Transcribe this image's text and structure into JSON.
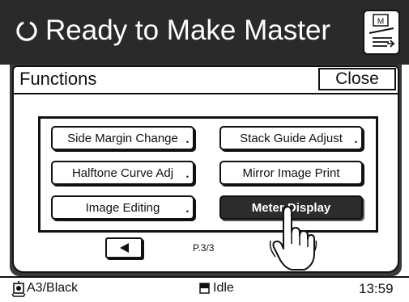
{
  "header": {
    "title": "Ready to Make Master",
    "status_icon": "circular-arrow-icon",
    "mode_icon": "master-mode-icon"
  },
  "panel": {
    "title": "Functions",
    "close_label": "Close"
  },
  "functions": [
    {
      "label": "Side Margin Change",
      "has_submenu": true,
      "selected": false
    },
    {
      "label": "Stack Guide Adjust",
      "has_submenu": true,
      "selected": false
    },
    {
      "label": "Halftone Curve Adj",
      "has_submenu": true,
      "selected": false
    },
    {
      "label": "Mirror Image Print",
      "has_submenu": false,
      "selected": false
    },
    {
      "label": "Image Editing",
      "has_submenu": true,
      "selected": false
    },
    {
      "label": "Meter Display",
      "has_submenu": false,
      "selected": true
    }
  ],
  "pager": {
    "page_label": "P.3/3",
    "prev_icon": "left-arrow-icon"
  },
  "status_bar": {
    "paper": "A3/Black",
    "paper_icon": "drum-icon",
    "state": "Idle",
    "state_icon": "document-icon",
    "time": "13:59"
  },
  "colors": {
    "header_bg": "#2a2a2a",
    "selected_bg": "#2c2c2c"
  }
}
